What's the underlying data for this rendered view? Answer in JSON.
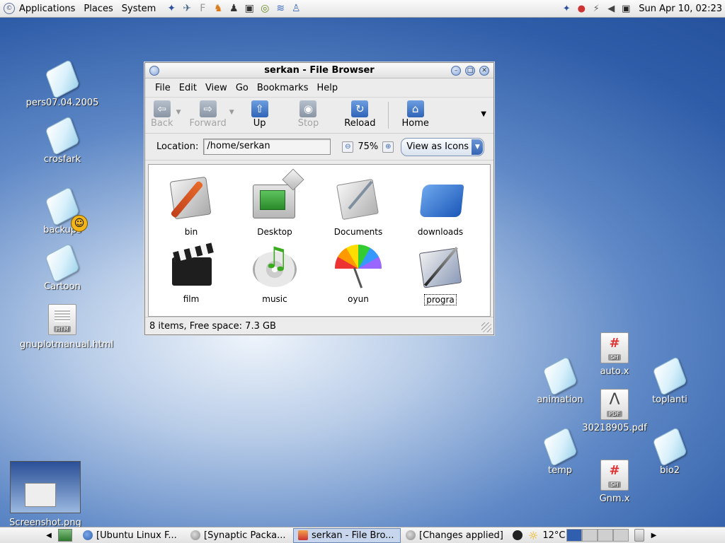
{
  "top_panel": {
    "menus": [
      "Applications",
      "Places",
      "System"
    ],
    "launchers": [
      "browser-icon",
      "bird-icon",
      "text-editor-icon",
      "gimp-icon",
      "penguin-icon",
      "terminal-icon",
      "cd-icon",
      "wifi-icon",
      "people-icon"
    ],
    "tray_icons": [
      "network-icon",
      "alert-icon",
      "plug-icon",
      "volume-icon",
      "display-icon"
    ],
    "clock": "Sun Apr 10, 02:23"
  },
  "desktop": {
    "icons_left": [
      {
        "name": "pers07.04.2005"
      },
      {
        "name": "crosfark"
      },
      {
        "name": "backups"
      },
      {
        "name": "Cartoon"
      },
      {
        "name": "gnuplotmanual.html",
        "badge": "HTM"
      },
      {
        "name": "Screenshot.png"
      }
    ],
    "icons_right": [
      {
        "name": "auto.x",
        "badge": "SH"
      },
      {
        "name": "animation"
      },
      {
        "name": "toplanti"
      },
      {
        "name": "30218905.pdf",
        "badge": "PDF"
      },
      {
        "name": "temp"
      },
      {
        "name": "bio2"
      },
      {
        "name": "Gnm.x",
        "badge": "SH"
      }
    ]
  },
  "window": {
    "title": "serkan - File Browser",
    "menus": [
      "File",
      "Edit",
      "View",
      "Go",
      "Bookmarks",
      "Help"
    ],
    "toolbar": {
      "back": "Back",
      "forward": "Forward",
      "up": "Up",
      "stop": "Stop",
      "reload": "Reload",
      "home": "Home"
    },
    "location_label": "Location:",
    "location_value": "/home/serkan",
    "zoom": "75%",
    "view_as": "View as Icons",
    "items": [
      "bin",
      "Desktop",
      "Documents",
      "downloads",
      "film",
      "music",
      "oyun",
      "progra"
    ],
    "status": "8 items, Free space: 7.3 GB"
  },
  "taskbar": {
    "tasks": [
      "[Ubuntu Linux F...",
      "[Synaptic Packa...",
      "serkan - File Bro...",
      "[Changes applied]"
    ],
    "temperature": "12°C"
  },
  "colors": {
    "desktop_blue": "#2f5da8",
    "active_task": "#c7d6ec"
  }
}
